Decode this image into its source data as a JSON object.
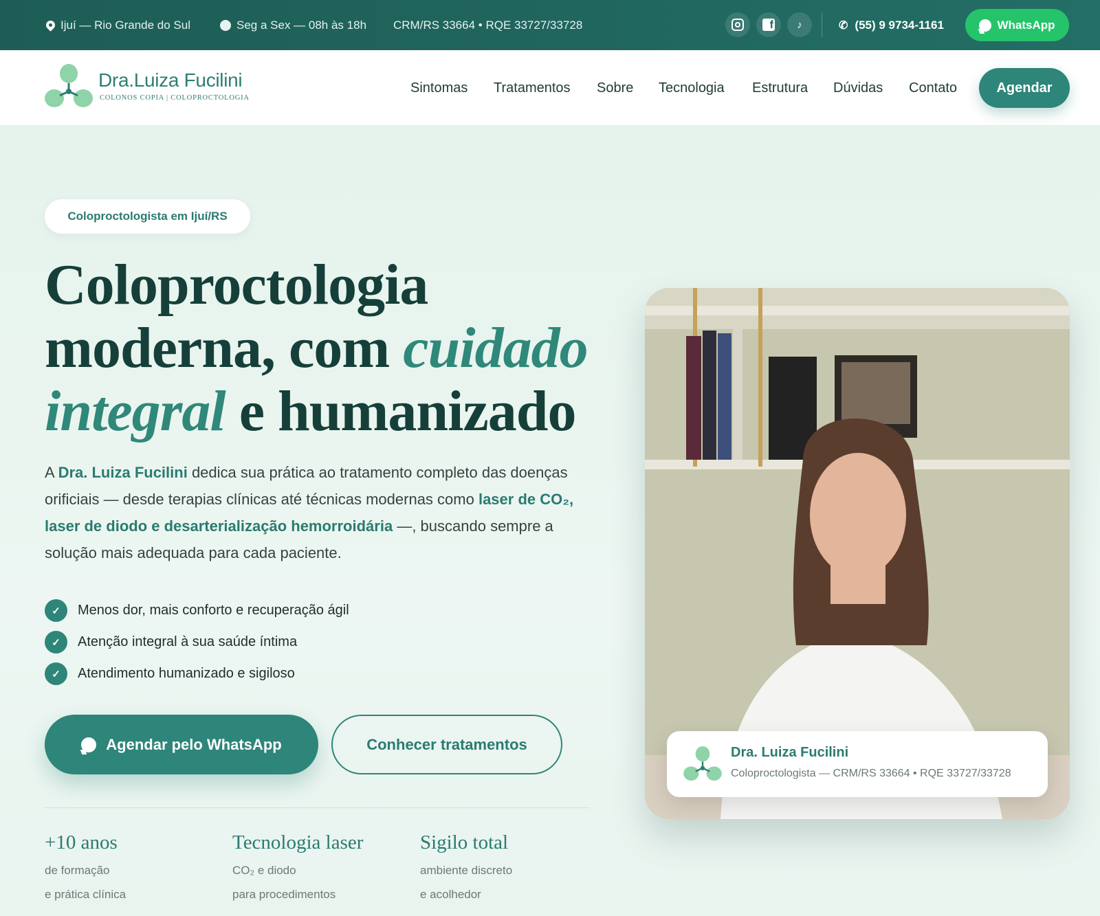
{
  "topbar": {
    "location": "Ijuí — Rio Grande do Sul",
    "hours": "Seg a Sex — 08h às 18h",
    "registration": "CRM/RS 33664 • RQE 33727/33728",
    "social_icons": [
      "instagram-icon",
      "facebook-icon",
      "tiktok-icon"
    ],
    "phone": "(55) 9 9734-1161",
    "whatsapp_label": "WhatsApp"
  },
  "nav": {
    "logo_name": "Dra.Luiza Fucilini",
    "logo_tagline": "COLONOS COPIA | COLOPROCTOLOGIA",
    "items": [
      "Sintomas",
      "Tratamentos",
      "Sobre",
      "Tecnologia",
      "Estrutura",
      "Dúvidas",
      "Contato"
    ],
    "cta": "Agendar"
  },
  "hero": {
    "badge": "Coloproctologista em Ijuí/RS",
    "headline": {
      "line1": "Coloproctologia",
      "line2a": "moderna, com ",
      "line2b": "cuidado",
      "line3a": "integral",
      "line3b": " e humanizado"
    },
    "lead": {
      "p1": "A ",
      "doctor": "Dra. Luiza Fucilini",
      "p2": " dedica sua prática ao tratamento completo das doenças orificiais — desde terapias clínicas até técnicas modernas como ",
      "techniques": "laser de CO₂, laser de diodo e desarterialização hemorroidária",
      "p3": " —, buscando sempre a solução mais adequada para cada paciente."
    },
    "checks": [
      "Menos dor, mais conforto e recuperação ágil",
      "Atenção integral à sua saúde íntima",
      "Atendimento humanizado e sigiloso"
    ],
    "primary_cta": "Agendar pelo WhatsApp",
    "secondary_cta": "Conhecer tratamentos",
    "stats": [
      {
        "title": "+10 anos",
        "line1": "de formação",
        "line2": "e prática clínica"
      },
      {
        "title": "Tecnologia laser",
        "line1": "CO₂ e diodo",
        "line2": "para procedimentos"
      },
      {
        "title": "Sigilo total",
        "line1": "ambiente discreto",
        "line2": "e acolhedor"
      }
    ],
    "card": {
      "name": "Dra. Luiza Fucilini",
      "subtitle": "Coloproctologista — CRM/RS 33664 • RQE 33727/33728"
    }
  },
  "colors": {
    "primary": "#2e8579",
    "topbar": "#1f625a",
    "whatsapp": "#25c46a",
    "heading": "#163f39"
  }
}
